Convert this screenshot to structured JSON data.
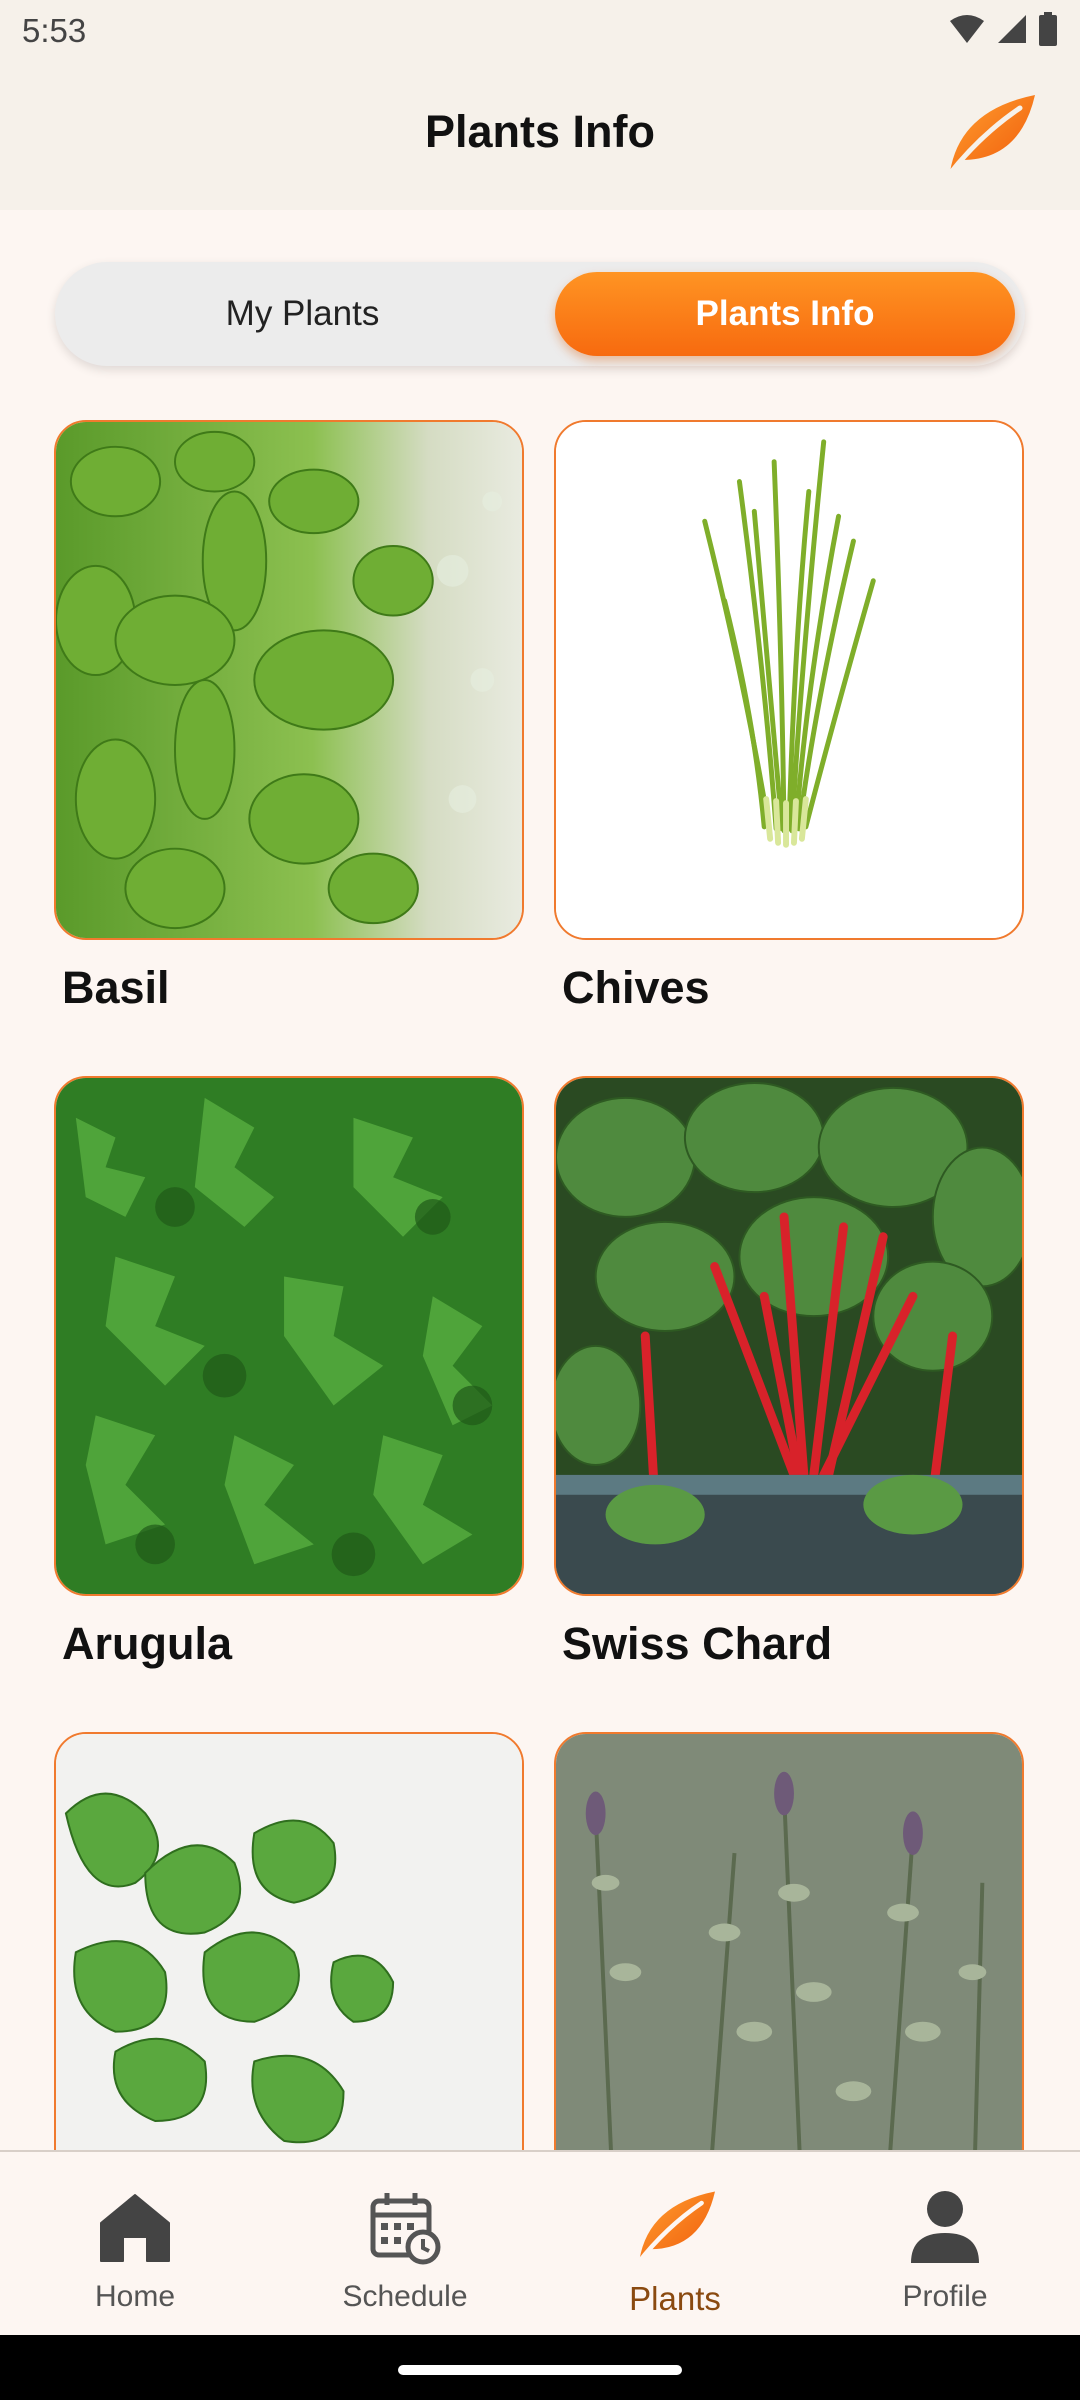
{
  "status_bar": {
    "time": "5:53"
  },
  "app_bar": {
    "title": "Plants Info",
    "logo_icon": "leaf-icon"
  },
  "segment": {
    "left_label": "My Plants",
    "right_label": "Plants Info",
    "selected": "right"
  },
  "plants": [
    {
      "name": "Basil"
    },
    {
      "name": "Chives"
    },
    {
      "name": "Arugula"
    },
    {
      "name": "Swiss Chard"
    },
    {
      "name": ""
    },
    {
      "name": ""
    }
  ],
  "nav": {
    "items": [
      {
        "label": "Home",
        "icon": "home-icon"
      },
      {
        "label": "Schedule",
        "icon": "calendar-clock-icon"
      },
      {
        "label": "Plants",
        "icon": "leaf-icon",
        "active": true
      },
      {
        "label": "Profile",
        "icon": "person-icon"
      }
    ]
  },
  "colors": {
    "accent": "#f76a0f",
    "accent_light": "#ff9423",
    "background": "#fdf6f2",
    "bar": "#f6f1ea"
  }
}
